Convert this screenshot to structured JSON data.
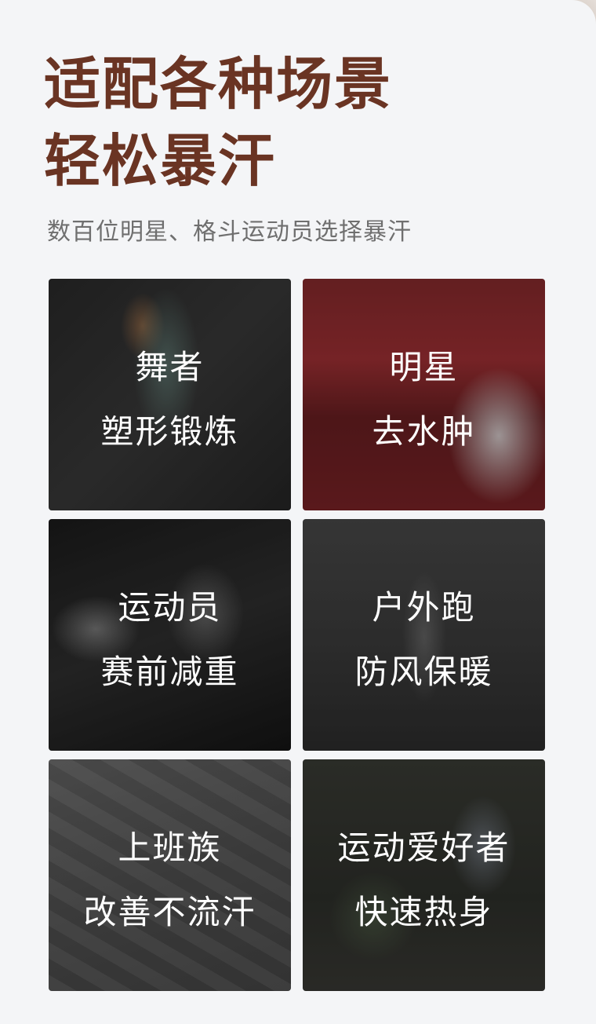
{
  "header": {
    "headline_line1": "适配各种场景",
    "headline_line2": "轻松暴汗",
    "subtitle": "数百位明星、格斗运动员选择暴汗"
  },
  "tiles": [
    {
      "line1": "舞者",
      "line2": "塑形锻炼"
    },
    {
      "line1": "明星",
      "line2": "去水肿"
    },
    {
      "line1": "运动员",
      "line2": "赛前减重"
    },
    {
      "line1": "户外跑",
      "line2": "防风保暖"
    },
    {
      "line1": "上班族",
      "line2": "改善不流汗"
    },
    {
      "line1": "运动爱好者",
      "line2": "快速热身"
    }
  ],
  "colors": {
    "headline": "#6a3423",
    "subtitle": "#6f6f6f",
    "background": "#f4f5f7"
  }
}
